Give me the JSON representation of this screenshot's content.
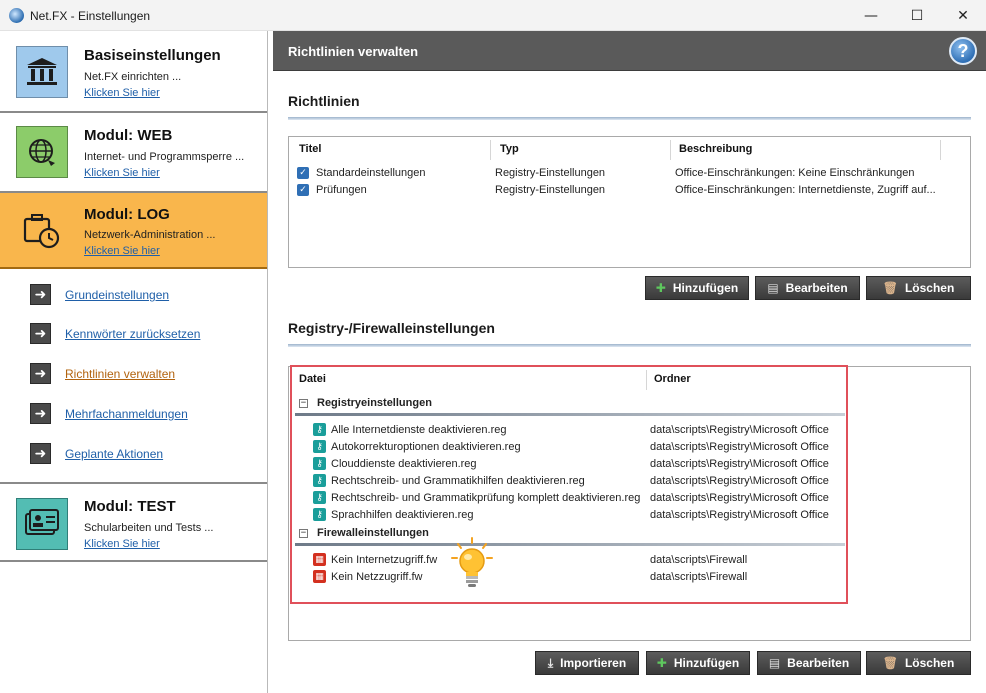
{
  "window": {
    "title": "Net.FX - Einstellungen",
    "controls": {
      "minimize": "—",
      "maximize": "☐",
      "close": "✕"
    }
  },
  "sidebar": {
    "modules": [
      {
        "title": "Basiseinstellungen",
        "description": "Net.FX einrichten ...",
        "link": "Klicken Sie hier",
        "icon": "bank-building-icon"
      },
      {
        "title": "Modul: WEB",
        "description": "Internet- und Programmsperre ...",
        "link": "Klicken Sie hier",
        "icon": "globe-icon"
      },
      {
        "title": "Modul: LOG",
        "description": "Netzwerk-Administration ...",
        "link": "Klicken Sie hier",
        "icon": "briefcase-clock-icon",
        "active": true
      },
      {
        "title": "Modul: TEST",
        "description": "Schularbeiten und Tests ...",
        "link": "Klicken Sie hier",
        "icon": "id-cards-icon"
      }
    ],
    "log_items": [
      {
        "label": "Grundeinstellungen"
      },
      {
        "label": "Kennwörter zurücksetzen"
      },
      {
        "label": "Richtlinien verwalten",
        "current": true
      },
      {
        "label": "Mehrfachanmeldungen"
      },
      {
        "label": "Geplante Aktionen"
      }
    ]
  },
  "main": {
    "header": {
      "title": "Richtlinien verwalten",
      "help": "?"
    },
    "policies": {
      "section_title": "Richtlinien",
      "columns": [
        "Titel",
        "Typ",
        "Beschreibung"
      ],
      "rows": [
        {
          "title": "Standardeinstellungen",
          "type": "Registry-Einstellungen",
          "description": "Office-Einschränkungen: Keine Einschränkungen",
          "checked": true
        },
        {
          "title": "Prüfungen",
          "type": "Registry-Einstellungen",
          "description": "Office-Einschränkungen: Internetdienste, Zugriff auf...",
          "checked": true
        }
      ],
      "buttons": {
        "add": "Hinzufügen",
        "edit": "Bearbeiten",
        "delete": "Löschen"
      }
    },
    "registry": {
      "section_title": "Registry-/Firewalleinstellungen",
      "columns": [
        "Datei",
        "Ordner"
      ],
      "groups": [
        {
          "name": "Registryeinstellungen",
          "toggle": "−",
          "kind": "reg",
          "files": [
            {
              "file": "Alle Internetdienste deaktivieren.reg",
              "folder": "data\\scripts\\Registry\\Microsoft Office"
            },
            {
              "file": "Autokorrekturoptionen deaktivieren.reg",
              "folder": "data\\scripts\\Registry\\Microsoft Office"
            },
            {
              "file": "Clouddienste deaktivieren.reg",
              "folder": "data\\scripts\\Registry\\Microsoft Office"
            },
            {
              "file": "Rechtschreib- und Grammatikhilfen deaktivieren.reg",
              "folder": "data\\scripts\\Registry\\Microsoft Office"
            },
            {
              "file": "Rechtschreib- und Grammatikprüfung komplett deaktivieren.reg",
              "folder": "data\\scripts\\Registry\\Microsoft Office"
            },
            {
              "file": "Sprachhilfen deaktivieren.reg",
              "folder": "data\\scripts\\Registry\\Microsoft Office"
            }
          ]
        },
        {
          "name": "Firewalleinstellungen",
          "toggle": "−",
          "kind": "fw",
          "files": [
            {
              "file": "Kein Internetzugriff.fw",
              "folder": "data\\scripts\\Firewall"
            },
            {
              "file": "Kein Netzzugriff.fw",
              "folder": "data\\scripts\\Firewall"
            }
          ]
        }
      ],
      "buttons": {
        "import": "Importieren",
        "add": "Hinzufügen",
        "edit": "Bearbeiten",
        "delete": "Löschen"
      }
    },
    "accent_colors": {
      "highlight": "#e0505a",
      "module_active": "#f9b64c",
      "link": "#1f5fa8"
    }
  }
}
